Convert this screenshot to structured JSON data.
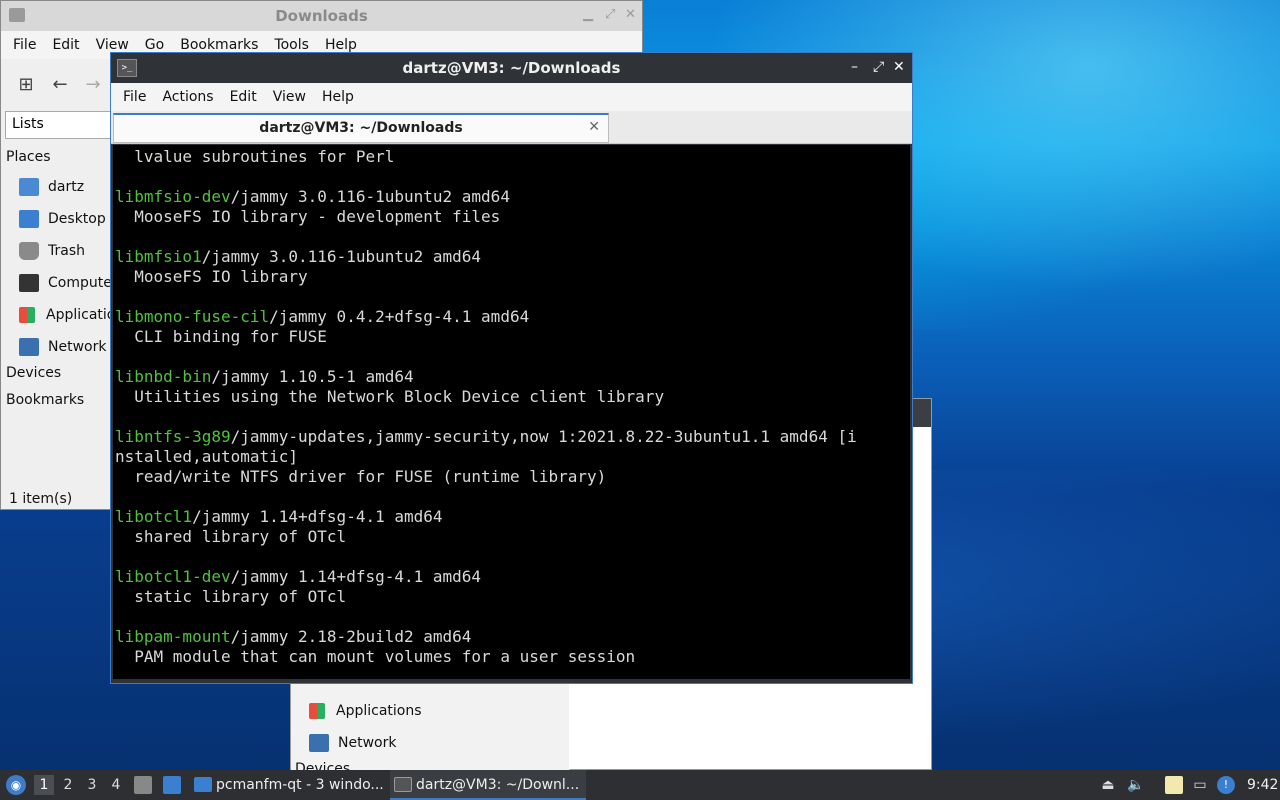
{
  "file_manager": {
    "title": "Downloads",
    "menu": [
      "File",
      "Edit",
      "View",
      "Go",
      "Bookmarks",
      "Tools",
      "Help"
    ],
    "lists_label": "Lists",
    "places_header": "Places",
    "places": [
      "dartz",
      "Desktop",
      "Trash",
      "Computer",
      "Applications",
      "Network"
    ],
    "devices_header": "Devices",
    "bookmarks_header": "Bookmarks",
    "status": "1 item(s)"
  },
  "file_manager_2": {
    "places": [
      "Applications",
      "Network"
    ],
    "devices_header": "Devices"
  },
  "terminal": {
    "title": "dartz@VM3: ~/Downloads",
    "menu": [
      "File",
      "Actions",
      "Edit",
      "View",
      "Help"
    ],
    "tab_label": "dartz@VM3: ~/Downloads",
    "lines": [
      {
        "pkg": "",
        "rest": "  lvalue subroutines for Perl"
      },
      {
        "pkg": "",
        "rest": ""
      },
      {
        "pkg": "libmfsio-dev",
        "rest": "/jammy 3.0.116-1ubuntu2 amd64"
      },
      {
        "pkg": "",
        "rest": "  MooseFS IO library - development files"
      },
      {
        "pkg": "",
        "rest": ""
      },
      {
        "pkg": "libmfsio1",
        "rest": "/jammy 3.0.116-1ubuntu2 amd64"
      },
      {
        "pkg": "",
        "rest": "  MooseFS IO library"
      },
      {
        "pkg": "",
        "rest": ""
      },
      {
        "pkg": "libmono-fuse-cil",
        "rest": "/jammy 0.4.2+dfsg-4.1 amd64"
      },
      {
        "pkg": "",
        "rest": "  CLI binding for FUSE"
      },
      {
        "pkg": "",
        "rest": ""
      },
      {
        "pkg": "libnbd-bin",
        "rest": "/jammy 1.10.5-1 amd64"
      },
      {
        "pkg": "",
        "rest": "  Utilities using the Network Block Device client library"
      },
      {
        "pkg": "",
        "rest": ""
      },
      {
        "pkg": "libntfs-3g89",
        "rest": "/jammy-updates,jammy-security,now 1:2021.8.22-3ubuntu1.1 amd64 [i"
      },
      {
        "pkg": "",
        "rest": "nstalled,automatic]"
      },
      {
        "pkg": "",
        "rest": "  read/write NTFS driver for FUSE (runtime library)"
      },
      {
        "pkg": "",
        "rest": ""
      },
      {
        "pkg": "libotcl1",
        "rest": "/jammy 1.14+dfsg-4.1 amd64"
      },
      {
        "pkg": "",
        "rest": "  shared library of OTcl"
      },
      {
        "pkg": "",
        "rest": ""
      },
      {
        "pkg": "libotcl1-dev",
        "rest": "/jammy 1.14+dfsg-4.1 amd64"
      },
      {
        "pkg": "",
        "rest": "  static library of OTcl"
      },
      {
        "pkg": "",
        "rest": ""
      },
      {
        "pkg": "libpam-mount",
        "rest": "/jammy 2.18-2build2 amd64"
      },
      {
        "pkg": "",
        "rest": "  PAM module that can mount volumes for a user session"
      }
    ]
  },
  "taskbar": {
    "workspaces": [
      "1",
      "2",
      "3",
      "4"
    ],
    "tasks": [
      {
        "label": "pcmanfm-qt - 3 windo..."
      },
      {
        "label": "dartz@VM3: ~/Downl..."
      }
    ],
    "clock": "9:42"
  },
  "colors": {
    "accent": "#3d7cc9",
    "package_name": "#4fc23b",
    "terminal_bg": "#000000",
    "titlebar_dark": "#2f3236"
  }
}
